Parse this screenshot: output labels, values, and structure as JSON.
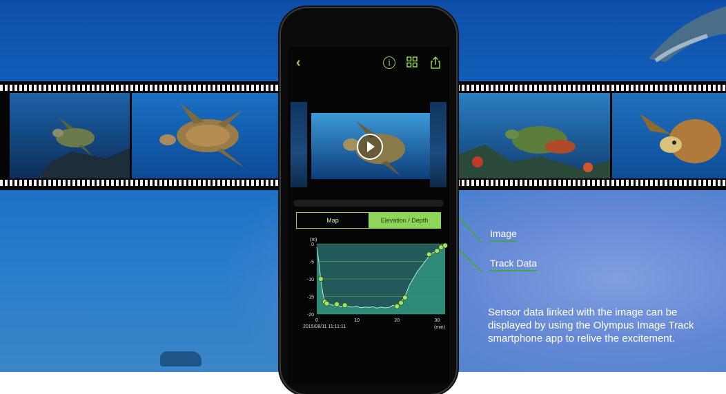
{
  "phone": {
    "topbar": {
      "back_icon": "chevron-left-icon",
      "info_icon": "info-icon",
      "grid_icon": "grid-icon",
      "share_icon": "share-icon",
      "accent": "#8ed65a"
    },
    "tabs": [
      {
        "label": "Map",
        "active": false
      },
      {
        "label": "Elevation / Depth",
        "active": true
      }
    ]
  },
  "callouts": {
    "image_label": "Image",
    "track_label": "Track Data"
  },
  "caption": "Sensor data linked with the image can be displayed by using the Olympus Image Track smartphone app to relive the excitement.",
  "chart_data": {
    "type": "area",
    "ylabel": "(m)",
    "xlabel": "(min)",
    "x_start_label": "2015/08/11 11:11:11",
    "xlim": [
      0,
      32
    ],
    "ylim": [
      -20,
      0
    ],
    "yticks": [
      0,
      -5,
      -10,
      -15,
      -20
    ],
    "xticks": [
      0,
      10,
      20,
      30
    ],
    "x": [
      0,
      0.5,
      1,
      1.5,
      2,
      3,
      4,
      5,
      6,
      7,
      8,
      9,
      10,
      11,
      12,
      13,
      14,
      15,
      16,
      17,
      18,
      19,
      20,
      21,
      22,
      23,
      24,
      25,
      26,
      27,
      28,
      29,
      30,
      31,
      32
    ],
    "y": [
      -1,
      -5,
      -10,
      -14,
      -16.5,
      -17,
      -17.5,
      -17.4,
      -17.8,
      -17.6,
      -17.9,
      -18,
      -17.8,
      -18.2,
      -18,
      -18.1,
      -17.9,
      -18.3,
      -18,
      -18.2,
      -18.1,
      -17.5,
      -17.8,
      -16.5,
      -15,
      -12,
      -10,
      -8,
      -6.5,
      -5,
      -3.5,
      -2.5,
      -2,
      -1,
      -0.5
    ],
    "markers_x": [
      1,
      2,
      2.5,
      5,
      7,
      20,
      21,
      22,
      28,
      30,
      31,
      32
    ],
    "markers_y": [
      -10,
      -16.5,
      -17,
      -17.2,
      -17.5,
      -17.8,
      -16.8,
      -15.3,
      -3,
      -2,
      -1,
      -0.5
    ],
    "fill_color": "#2f8d7a",
    "marker_color": "#a7e06a"
  }
}
